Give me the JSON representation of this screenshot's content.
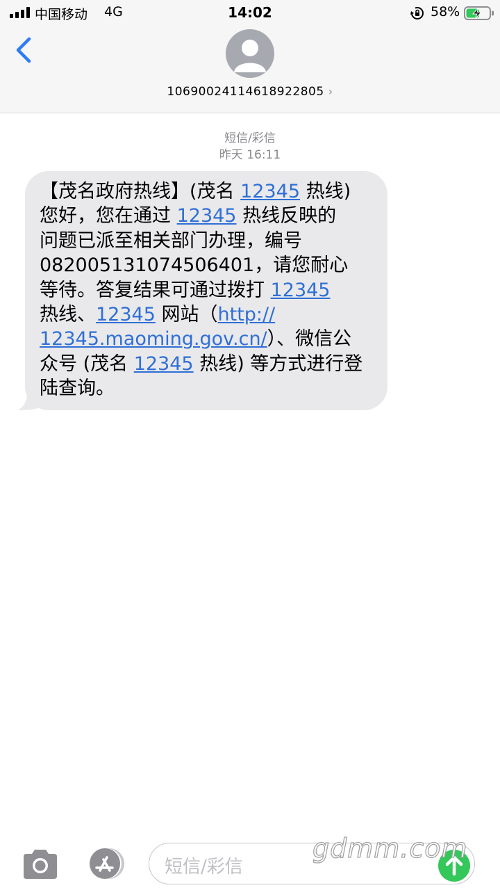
{
  "status_bar": {
    "carrier": "中国移动",
    "network": "4G",
    "time": "14:02",
    "battery_percent": "58%",
    "battery_level": 0.58
  },
  "header": {
    "contact_number": "106900241146189228​05",
    "chevron": "›"
  },
  "thread": {
    "message_type": "短信/彩信",
    "date": "昨天 16:11"
  },
  "message": {
    "lines": [
      [
        {
          "t": "【茂名政府热线】(茂名 "
        },
        {
          "t": "12345",
          "link": true
        },
        {
          "t": " 热线)"
        }
      ],
      [
        {
          "t": "您好，您在通过 "
        },
        {
          "t": "12345",
          "link": true
        },
        {
          "t": " 热线反映的"
        }
      ],
      [
        {
          "t": "问题已派至相关部门办理，编号"
        }
      ],
      [
        {
          "t": "082005131074506401，请您耐心"
        }
      ],
      [
        {
          "t": "等待。答复结果可通过拨打 "
        },
        {
          "t": "12345",
          "link": true
        }
      ],
      [
        {
          "t": "热线、"
        },
        {
          "t": "12345",
          "link": true
        },
        {
          "t": " 网站（"
        },
        {
          "t": "http://",
          "link": true
        }
      ],
      [
        {
          "t": "12345.maoming.gov.cn/",
          "link": true
        },
        {
          "t": "）、微信公"
        }
      ],
      [
        {
          "t": "众号 (茂名 "
        },
        {
          "t": "12345",
          "link": true
        },
        {
          "t": " 热线) 等方式进行登"
        }
      ],
      [
        {
          "t": "陆查询。"
        }
      ]
    ]
  },
  "input_bar": {
    "placeholder": "短信/彩信"
  },
  "watermark": "gdmm.com",
  "colors": {
    "accent": "#2f7cf6",
    "link": "#2f6fd6",
    "bubble": "#e9e9eb",
    "send": "#34c759"
  }
}
